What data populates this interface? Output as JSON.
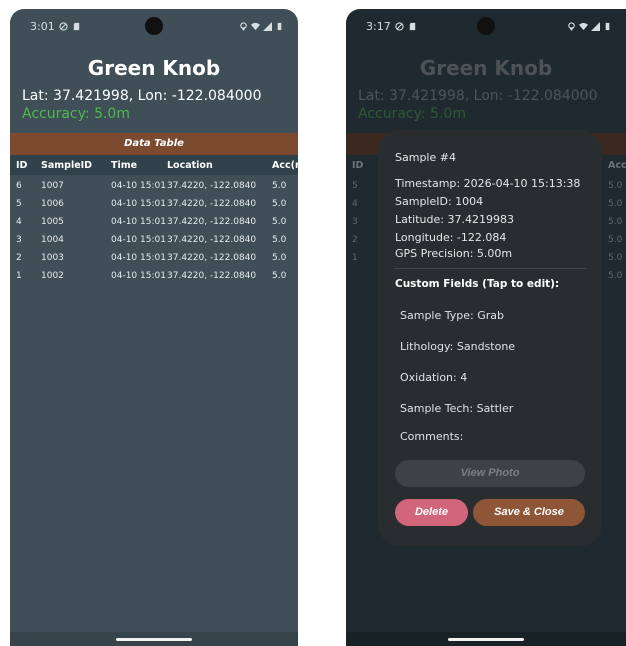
{
  "colors": {
    "accent_brown": "#7c4a2f",
    "accuracy_green": "#4cbb4c",
    "delete_pink": "#d1657a",
    "save_brown": "#8e5637"
  },
  "left": {
    "status": {
      "time": "3:01"
    },
    "title": "Green Knob",
    "latlon": "Lat: 37.421998, Lon: -122.084000",
    "accuracy": "Accuracy: 5.0m",
    "table": {
      "title": "Data Table",
      "headers": [
        "ID",
        "SampleID",
        "Time",
        "Location",
        "Acc(r"
      ],
      "rows": [
        [
          "6",
          "1007",
          "04-10 15:01",
          "37.4220, -122.0840",
          "5.0"
        ],
        [
          "5",
          "1006",
          "04-10 15:01",
          "37.4220, -122.0840",
          "5.0"
        ],
        [
          "4",
          "1005",
          "04-10 15:01",
          "37.4220, -122.0840",
          "5.0"
        ],
        [
          "3",
          "1004",
          "04-10 15:01",
          "37.4220, -122.0840",
          "5.0"
        ],
        [
          "2",
          "1003",
          "04-10 15:01",
          "37.4220, -122.0840",
          "5.0"
        ],
        [
          "1",
          "1002",
          "04-10 15:01",
          "37.4220, -122.0840",
          "5.0"
        ]
      ]
    }
  },
  "right": {
    "status": {
      "time": "3:17"
    },
    "title": "Green Knob",
    "latlon": "Lat: 37.421998, Lon: -122.084000",
    "accuracy": "Accuracy: 5.0m",
    "table": {
      "headers": [
        "ID",
        "Acc"
      ],
      "ids": [
        "5",
        "4",
        "3",
        "2",
        "1"
      ],
      "accs": [
        "5.0",
        "5.0",
        "5.0",
        "5.0",
        "5.0",
        "5.0"
      ]
    },
    "dialog": {
      "title": "Sample #4",
      "timestamp": "Timestamp: 2026-04-10 15:13:38",
      "sample_id": "SampleID: 1004",
      "latitude": "Latitude: 37.4219983",
      "longitude": "Longitude: -122.084",
      "gps_precision": "GPS Precision: 5.00m",
      "section": "Custom Fields (Tap to edit):",
      "fields": [
        "Sample Type: Grab",
        "Lithology: Sandstone",
        "Oxidation: 4",
        "Sample Tech: Sattler",
        "Comments:"
      ],
      "view_photo": "View Photo",
      "delete": "Delete",
      "save_close": "Save & Close"
    }
  }
}
